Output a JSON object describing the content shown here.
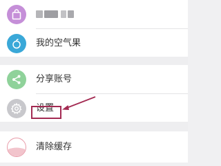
{
  "profile": {
    "name": "",
    "icon": "shopping-bag-icon",
    "color": "#c58fd8"
  },
  "menu": {
    "items": [
      {
        "label": "我的空气果",
        "icon": "fruit-icon",
        "color": "#3aa8d8"
      },
      {
        "label": "分享账号",
        "icon": "share-icon",
        "color": "#8fd29a"
      },
      {
        "label": "设置",
        "icon": "gear-icon",
        "color": "#c8c8cc"
      },
      {
        "label": "清除缓存",
        "icon": "clear-cache-icon",
        "color": "#e89aa8"
      }
    ]
  },
  "annotation": {
    "color": "#a32a52",
    "target": "设置"
  }
}
